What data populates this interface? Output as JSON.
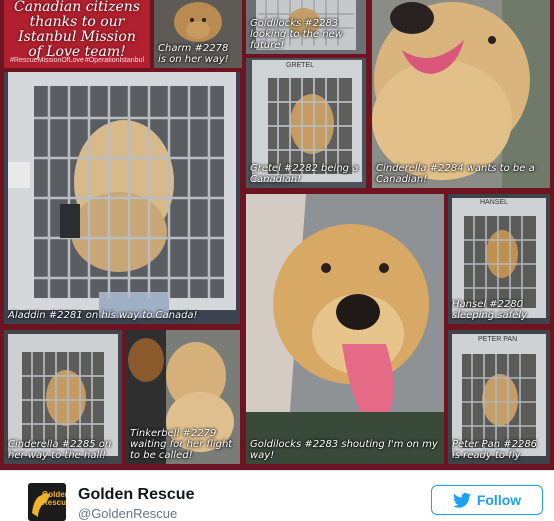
{
  "collage": {
    "banner": {
      "text": "Canadian citizens thanks to our Istanbul Mission of Love team!",
      "hashtag_left": "#RescueMissionOfLove",
      "hashtag_right": "#OperationIstanbul"
    },
    "captions": [
      "Charm #2278 is on her way!",
      "Goldilocks #2283 looking to the new future!",
      "Aladdin #2281 on his way to Canada!",
      "Gretel #2282 being a Canadian!",
      "Cinderella #2284 wants to be a Canadian!",
      "Hansel #2280 sleeping safely",
      "Cinderella #2285 on her way to the hall!",
      "Tinkerbell #2279 waiting for her flight to be called!",
      "Goldilocks #2283 shouting I'm on my way!",
      "Peter Pan #2286 is ready to fly"
    ],
    "crate_labels": {
      "gretel": "GRETEL",
      "hansel": "HANSEL",
      "peter_pan": "PETER PAN"
    }
  },
  "account": {
    "name": "Golden Rescue",
    "handle": "@GoldenRescue",
    "avatar_text": "Golden Rescue"
  },
  "follow_button": {
    "label": "Follow",
    "color": "#1da1f2"
  },
  "colors": {
    "collage_border": "#6e1420",
    "dog_golden": "#d2a86a",
    "crate_grey": "#c9cdd1"
  }
}
